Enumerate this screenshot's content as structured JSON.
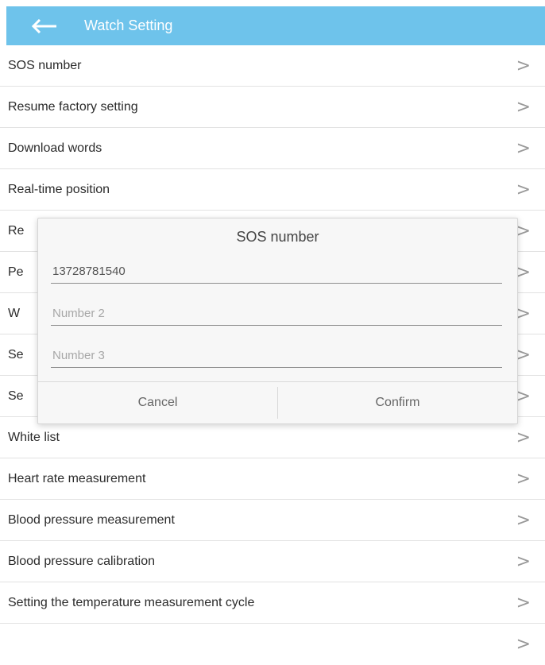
{
  "app_bar": {
    "title": "Watch Setting",
    "back_icon": "arrow-left-icon",
    "color": "#6ec3eb"
  },
  "settings": {
    "items": [
      {
        "label": "SOS number"
      },
      {
        "label": "Resume factory setting"
      },
      {
        "label": "Download words"
      },
      {
        "label": "Real-time position"
      },
      {
        "label": "Re"
      },
      {
        "label": "Pe"
      },
      {
        "label": "W"
      },
      {
        "label": "Se"
      },
      {
        "label": "Se"
      },
      {
        "label": "White list"
      },
      {
        "label": "Heart rate measurement"
      },
      {
        "label": "Blood pressure measurement"
      },
      {
        "label": "Blood pressure calibration"
      },
      {
        "label": "Setting the temperature measurement cycle"
      },
      {
        "label": ""
      }
    ],
    "chevron": ">"
  },
  "dialog": {
    "title": "SOS number",
    "fields": [
      {
        "value": "13728781540",
        "placeholder": ""
      },
      {
        "value": "",
        "placeholder": "Number 2"
      },
      {
        "value": "",
        "placeholder": "Number 3"
      }
    ],
    "cancel_label": "Cancel",
    "confirm_label": "Confirm"
  }
}
